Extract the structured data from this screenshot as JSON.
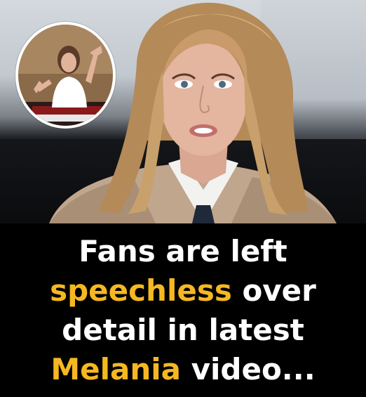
{
  "headline": {
    "line1": "Fans are left",
    "line2_highlight": "speechless",
    "line2_rest": " over",
    "line3": "detail in latest",
    "line4_highlight": "Melania",
    "line4_rest": " video..."
  },
  "colors": {
    "background": "#000000",
    "text": "#ffffff",
    "accent": "#f6b821"
  }
}
